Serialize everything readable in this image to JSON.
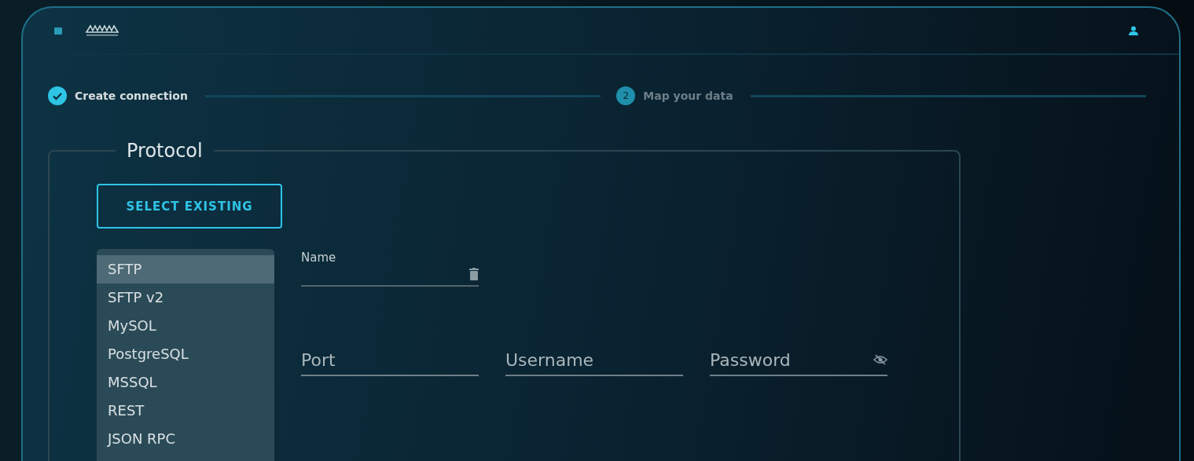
{
  "steps": [
    {
      "label": "Create connection",
      "completed": true
    },
    {
      "label": "Map your data",
      "number": "2",
      "completed": false
    }
  ],
  "protocol": {
    "legend": "Protocol",
    "select_button": "SELECT EXISTING",
    "options": [
      {
        "label": "SFTP",
        "selected": true
      },
      {
        "label": "SFTP v2",
        "selected": false
      },
      {
        "label": "MySOL",
        "selected": false
      },
      {
        "label": "PostgreSQL",
        "selected": false
      },
      {
        "label": "MSSQL",
        "selected": false
      },
      {
        "label": "REST",
        "selected": false
      },
      {
        "label": "JSON RPC",
        "selected": false
      }
    ],
    "name_field": {
      "label": "Name"
    },
    "fields": [
      {
        "placeholder": "Port",
        "kind": "text"
      },
      {
        "placeholder": "Username",
        "kind": "text"
      },
      {
        "placeholder": "Password",
        "kind": "password"
      }
    ]
  }
}
